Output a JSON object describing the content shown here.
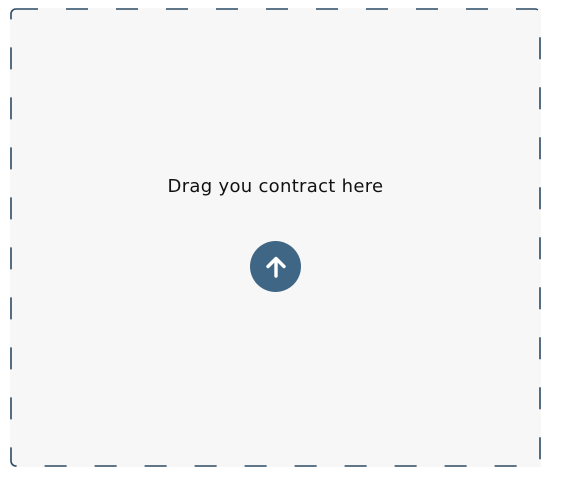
{
  "dropzone": {
    "label": "Drag you contract here",
    "upload_icon": "arrow-up-icon",
    "accent_color": "#3f6685",
    "border_color": "#2d4a63",
    "background_color": "#f7f7f7"
  }
}
